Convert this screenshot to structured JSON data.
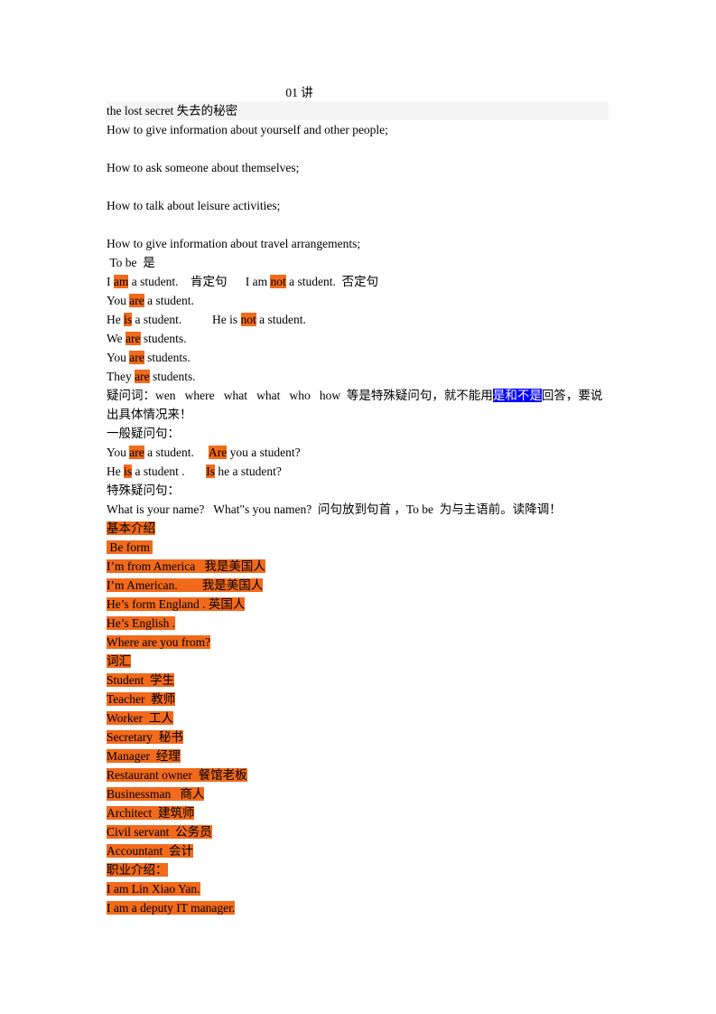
{
  "document": {
    "title": "01 讲",
    "heading_line": "the lost secret 失去的秘密",
    "objectives": [
      "How to give information about yourself and other people;",
      "How to ask someone about themselves;",
      "How to talk about leisure activities;",
      "How to give information about travel arrangements;"
    ],
    "tobe_heading": " To be  是",
    "grammar_lines": [
      {
        "segments": [
          {
            "text": "I ",
            "hl": "none"
          },
          {
            "text": "am",
            "hl": "orange"
          },
          {
            "text": " a student.    肯定句      I am ",
            "hl": "none"
          },
          {
            "text": "not",
            "hl": "orange"
          },
          {
            "text": " a student.  否定句",
            "hl": "none"
          }
        ]
      },
      {
        "segments": [
          {
            "text": "You ",
            "hl": "none"
          },
          {
            "text": "are",
            "hl": "orange"
          },
          {
            "text": " a student.",
            "hl": "none"
          }
        ]
      },
      {
        "segments": [
          {
            "text": "He ",
            "hl": "none"
          },
          {
            "text": "is",
            "hl": "orange"
          },
          {
            "text": " a student.          He is ",
            "hl": "none"
          },
          {
            "text": "not",
            "hl": "orange"
          },
          {
            "text": " a student.",
            "hl": "none"
          }
        ]
      },
      {
        "segments": [
          {
            "text": "We ",
            "hl": "none"
          },
          {
            "text": "are",
            "hl": "orange"
          },
          {
            "text": " students.",
            "hl": "none"
          }
        ]
      },
      {
        "segments": [
          {
            "text": "You ",
            "hl": "none"
          },
          {
            "text": "are",
            "hl": "orange"
          },
          {
            "text": " students.",
            "hl": "none"
          }
        ]
      },
      {
        "segments": [
          {
            "text": "They ",
            "hl": "none"
          },
          {
            "text": "are",
            "hl": "orange"
          },
          {
            "text": " students.",
            "hl": "none"
          }
        ]
      }
    ],
    "question_words_note": {
      "prefix": "疑问词：wen   where   what   what   who   how  等是特殊疑问句，就不能用",
      "blue": "是和不是",
      "suffix": "回答，要说出具体情况来！"
    },
    "general_q_heading": "一般疑问句：",
    "general_q_lines": [
      {
        "segments": [
          {
            "text": "You ",
            "hl": "none"
          },
          {
            "text": "are",
            "hl": "orange"
          },
          {
            "text": " a student.     ",
            "hl": "none"
          },
          {
            "text": "Are",
            "hl": "orange"
          },
          {
            "text": " you a student?",
            "hl": "none"
          }
        ]
      },
      {
        "segments": [
          {
            "text": "He ",
            "hl": "none"
          },
          {
            "text": "is",
            "hl": "orange"
          },
          {
            "text": " a student .       ",
            "hl": "none"
          },
          {
            "text": "Is",
            "hl": "orange"
          },
          {
            "text": " he a student?",
            "hl": "none"
          }
        ]
      }
    ],
    "special_q_heading": "特殊疑问句：",
    "special_q_line": "What is your name?   What\"s you namen?  问句放到句首 ，To be  为与主语前。读降调！",
    "orange_blocks": [
      "基本介绍",
      " Be form ",
      "I’m from America   我是美国人",
      "I’m American.        我是美国人",
      "He’s form England . 英国人",
      "He’s English .",
      "Where are you from?",
      "词汇",
      "Student  学生",
      "Teacher  教师",
      "Worker  工人",
      "Secretary  秘书",
      "Manager  经理",
      "Restaurant owner  餐馆老板",
      "Businessman   商人",
      "Architect  建筑师",
      "Civil servant  公务员",
      "Accountant  会计",
      "职业介绍：",
      "I am Lin Xiao Yan.",
      "I am a deputy IT manager."
    ]
  },
  "colors": {
    "highlight_orange": "#f26a1b",
    "highlight_blue": "#0000ff",
    "highlight_gray": "#f4f4f4",
    "text": "#000000"
  }
}
